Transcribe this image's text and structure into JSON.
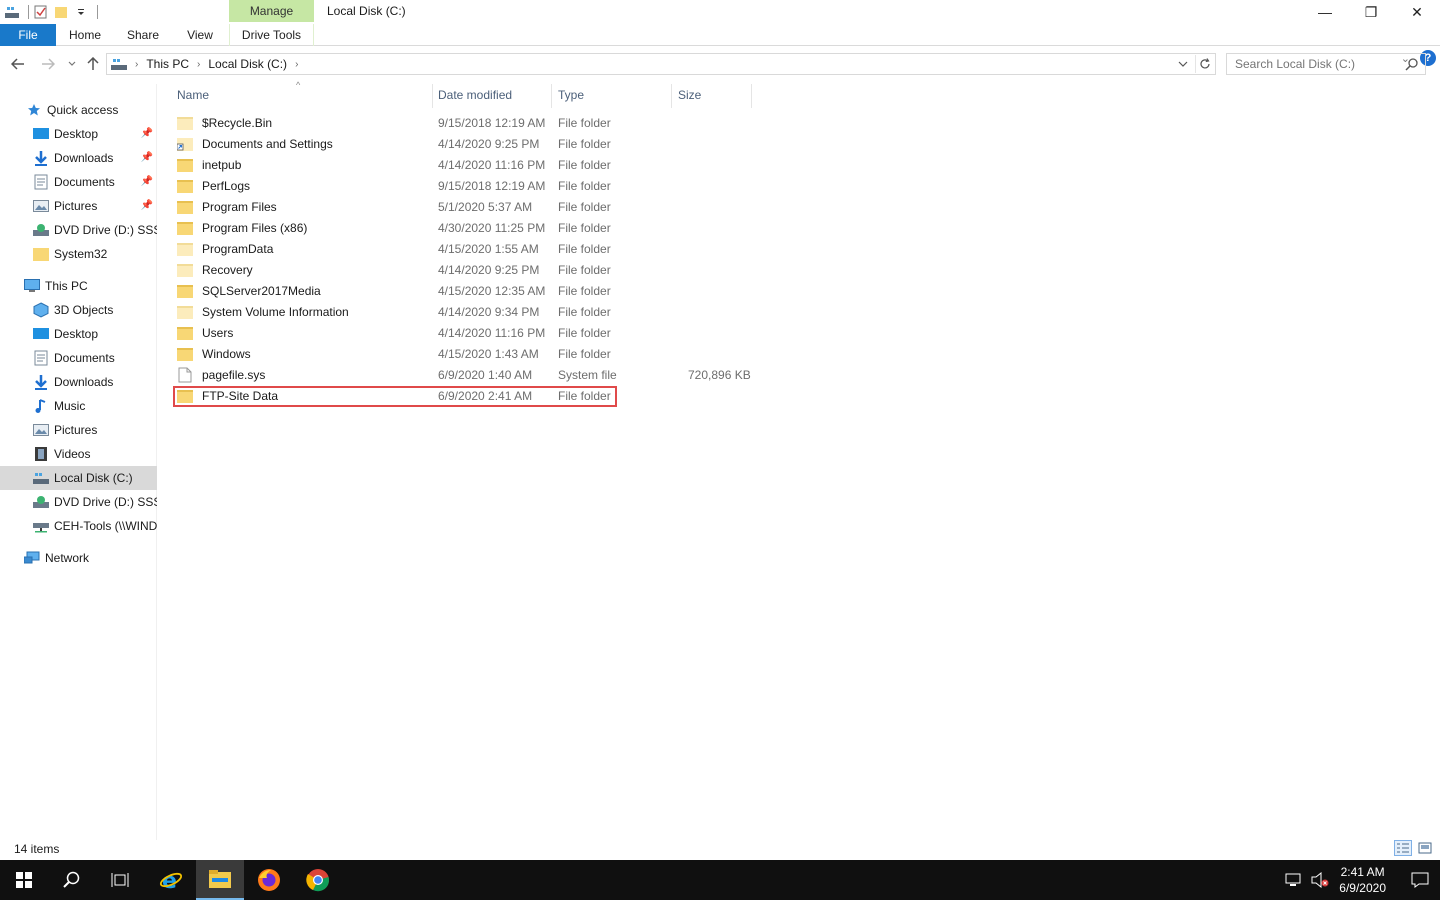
{
  "window": {
    "title": "Local Disk (C:)",
    "minimize": "—",
    "restore": "❐",
    "close": "✕"
  },
  "ribbon": {
    "context_group": "Manage",
    "tabs": {
      "file": "File",
      "home": "Home",
      "share": "Share",
      "view": "View",
      "drive_tools": "Drive Tools"
    },
    "help": "?"
  },
  "address": {
    "crumbs": [
      "This PC",
      "Local Disk (C:)"
    ],
    "search_placeholder": "Search Local Disk (C:)"
  },
  "nav": {
    "quick_access": "Quick access",
    "quick_items": [
      "Desktop",
      "Downloads",
      "Documents",
      "Pictures",
      "DVD Drive (D:) SSS_X",
      "System32"
    ],
    "this_pc": "This PC",
    "pc_items": [
      "3D Objects",
      "Desktop",
      "Documents",
      "Downloads",
      "Music",
      "Pictures",
      "Videos",
      "Local Disk (C:)",
      "DVD Drive (D:) SSS_X",
      "CEH-Tools (\\\\WIND"
    ],
    "network": "Network"
  },
  "columns": {
    "name": "Name",
    "date": "Date modified",
    "type": "Type",
    "size": "Size"
  },
  "files": [
    {
      "name": "$Recycle.Bin",
      "date": "9/15/2018 12:19 AM",
      "type": "File folder",
      "size": "",
      "icon": "folder-faint"
    },
    {
      "name": "Documents and Settings",
      "date": "4/14/2020 9:25 PM",
      "type": "File folder",
      "size": "",
      "icon": "folder-shortcut"
    },
    {
      "name": "inetpub",
      "date": "4/14/2020 11:16 PM",
      "type": "File folder",
      "size": "",
      "icon": "folder"
    },
    {
      "name": "PerfLogs",
      "date": "9/15/2018 12:19 AM",
      "type": "File folder",
      "size": "",
      "icon": "folder"
    },
    {
      "name": "Program Files",
      "date": "5/1/2020 5:37 AM",
      "type": "File folder",
      "size": "",
      "icon": "folder"
    },
    {
      "name": "Program Files (x86)",
      "date": "4/30/2020 11:25 PM",
      "type": "File folder",
      "size": "",
      "icon": "folder"
    },
    {
      "name": "ProgramData",
      "date": "4/15/2020 1:55 AM",
      "type": "File folder",
      "size": "",
      "icon": "folder-faint"
    },
    {
      "name": "Recovery",
      "date": "4/14/2020 9:25 PM",
      "type": "File folder",
      "size": "",
      "icon": "folder-faint"
    },
    {
      "name": "SQLServer2017Media",
      "date": "4/15/2020 12:35 AM",
      "type": "File folder",
      "size": "",
      "icon": "folder"
    },
    {
      "name": "System Volume Information",
      "date": "4/14/2020 9:34 PM",
      "type": "File folder",
      "size": "",
      "icon": "folder-faint"
    },
    {
      "name": "Users",
      "date": "4/14/2020 11:16 PM",
      "type": "File folder",
      "size": "",
      "icon": "folder"
    },
    {
      "name": "Windows",
      "date": "4/15/2020 1:43 AM",
      "type": "File folder",
      "size": "",
      "icon": "folder"
    },
    {
      "name": "pagefile.sys",
      "date": "6/9/2020 1:40 AM",
      "type": "System file",
      "size": "720,896 KB",
      "icon": "file"
    },
    {
      "name": "FTP-Site Data",
      "date": "6/9/2020 2:41 AM",
      "type": "File folder",
      "size": "",
      "icon": "folder"
    }
  ],
  "status": {
    "item_count": "14 items"
  },
  "taskbar": {
    "time": "2:41 AM",
    "date": "6/9/2020"
  },
  "colors": {
    "file_tab": "#1979ca",
    "manage_tab": "#c6e7a4",
    "highlight": "#e04a4a",
    "folder": "#f8d775"
  }
}
